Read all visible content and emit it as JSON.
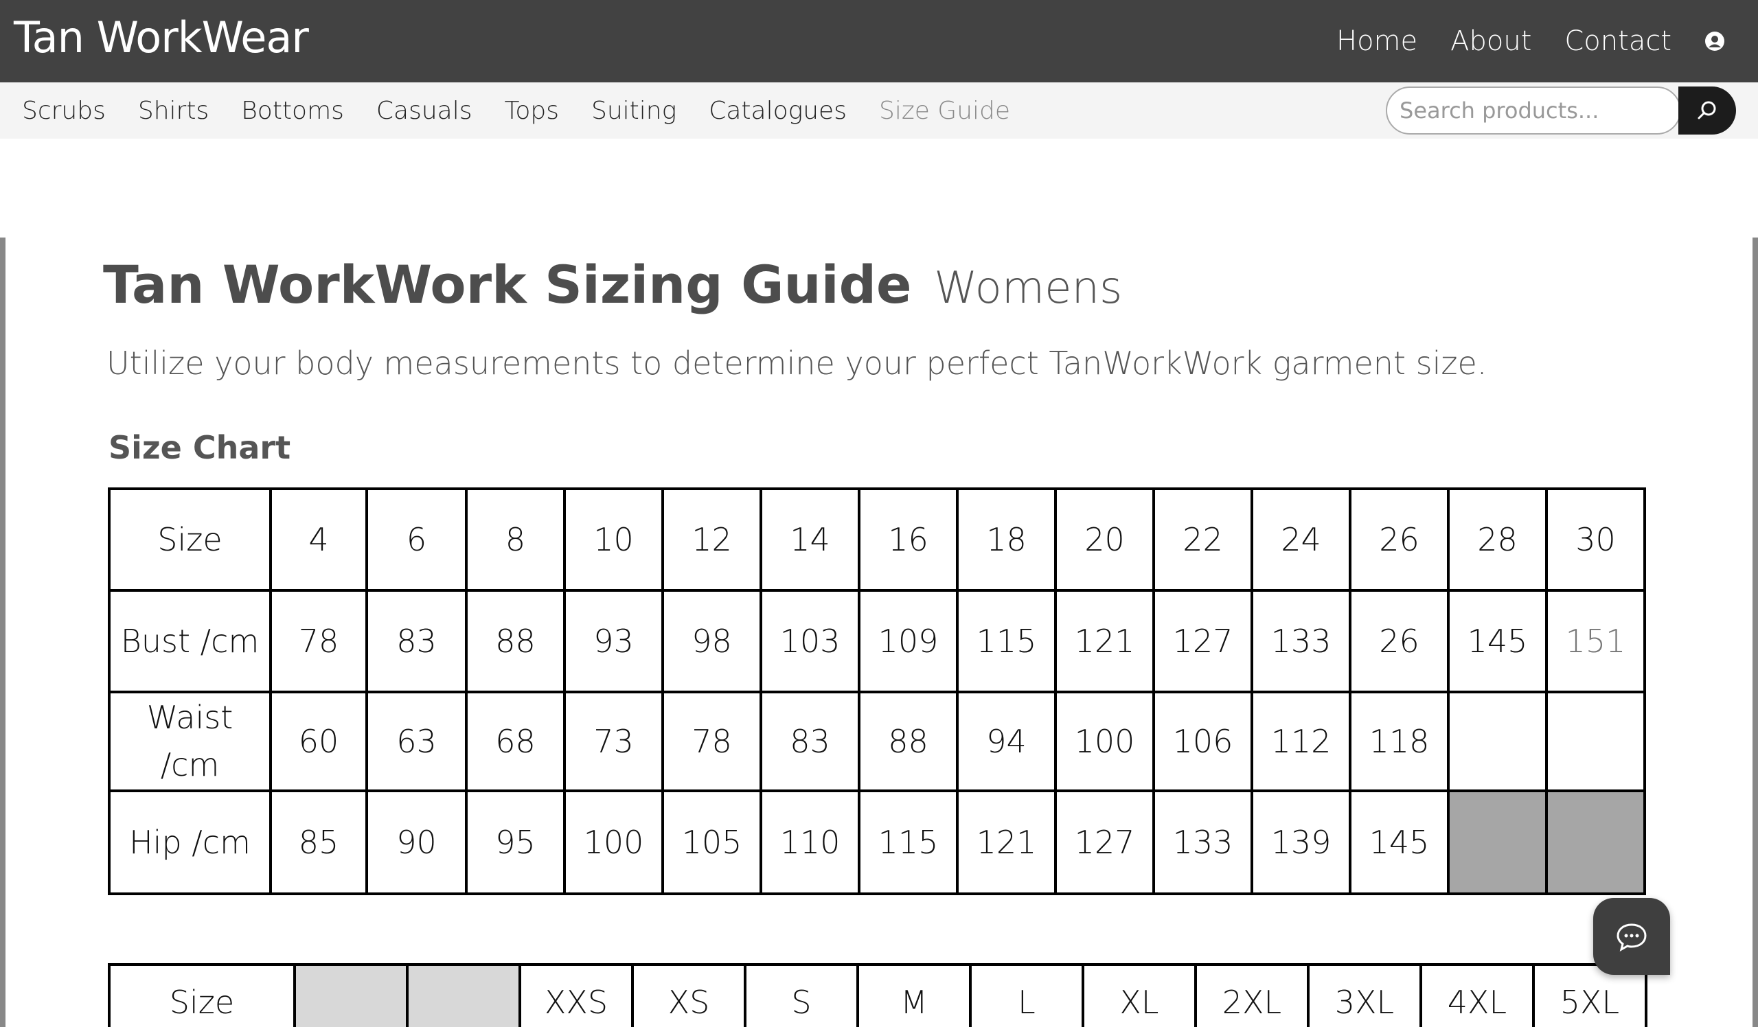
{
  "header": {
    "brand": "Tan WorkWear",
    "nav": [
      "Home",
      "About",
      "Contact"
    ],
    "account_icon": "user-circle-icon"
  },
  "categories": [
    "Scrubs",
    "Shirts",
    "Bottoms",
    "Casuals",
    "Tops",
    "Suiting",
    "Catalogues",
    "Size Guide"
  ],
  "active_category": "Size Guide",
  "search": {
    "placeholder": "Search products...",
    "value": "",
    "icon": "search-icon"
  },
  "page": {
    "title": "Tan WorkWork Sizing Guide",
    "title_suffix": "Womens",
    "intro": "Utilize your body measurements to determine your perfect TanWorkWork garment size.",
    "section_heading": "Size Chart"
  },
  "size_chart": {
    "rows": [
      {
        "label": "Size",
        "cells": [
          "4",
          "6",
          "8",
          "10",
          "12",
          "14",
          "16",
          "18",
          "20",
          "22",
          "24",
          "26",
          "28",
          "30"
        ]
      },
      {
        "label": "Bust /cm",
        "cells": [
          "78",
          "83",
          "88",
          "93",
          "98",
          "103",
          "109",
          "115",
          "121",
          "127",
          "133",
          "26",
          "145",
          "151"
        ]
      },
      {
        "label": "Waist /cm",
        "cells": [
          "60",
          "63",
          "68",
          "73",
          "78",
          "83",
          "88",
          "94",
          "100",
          "106",
          "112",
          "118",
          "",
          ""
        ]
      },
      {
        "label": "Hip /cm",
        "cells": [
          "85",
          "90",
          "95",
          "100",
          "105",
          "110",
          "115",
          "121",
          "127",
          "133",
          "139",
          "145",
          "",
          ""
        ]
      }
    ]
  },
  "size_chart_2": {
    "label": "Size",
    "cells": [
      "",
      "",
      "XXS",
      "XS",
      "S",
      "M",
      "L",
      "XL",
      "2XL",
      "3XL",
      "4XL",
      "5XL"
    ]
  },
  "chat": {
    "icon": "chat-bubble-icon"
  },
  "colors": {
    "header_bg": "#424242",
    "catbar_bg": "#f4f4f4",
    "active_category": "#8a8a8a",
    "empty_cell": "#a6a6a6"
  }
}
